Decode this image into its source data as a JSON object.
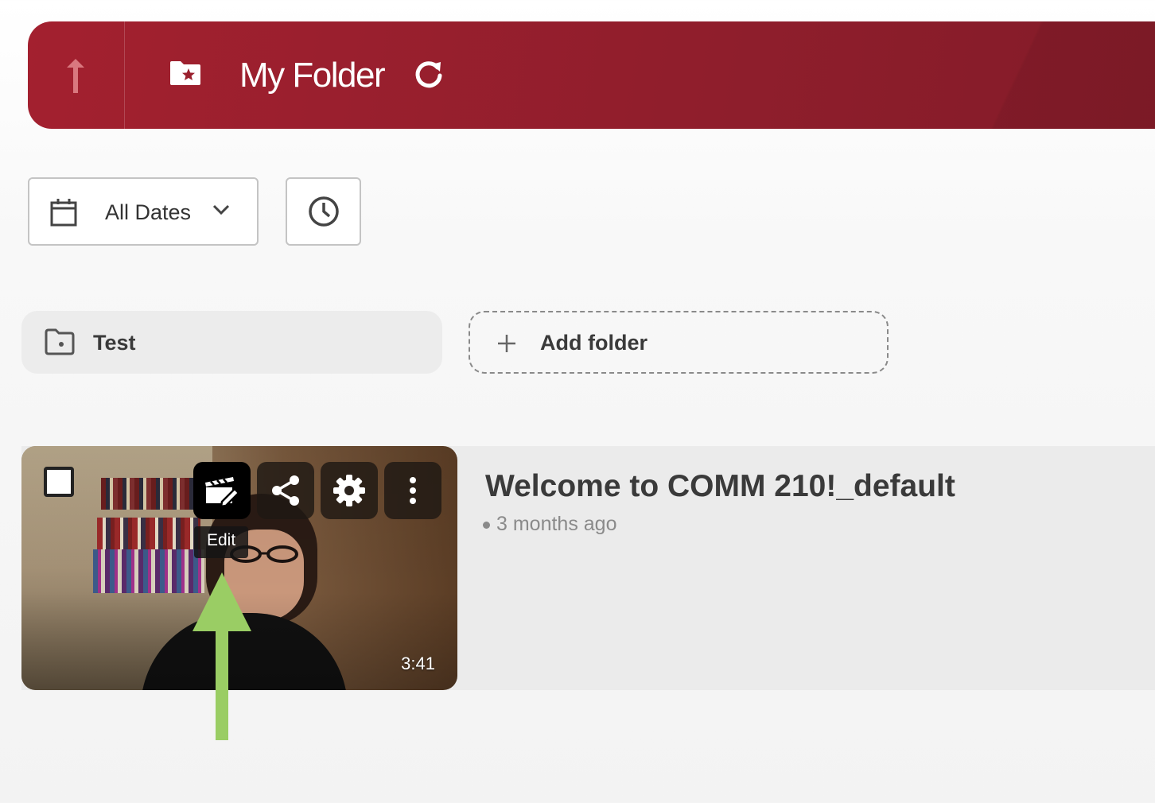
{
  "header": {
    "title": "My Folder",
    "up_icon": "arrow-up-icon",
    "folder_icon": "folder-star-icon",
    "refresh_icon": "refresh-icon",
    "accent_color": "#9a1f2d"
  },
  "filters": {
    "date_label": "All Dates",
    "date_icon": "calendar-icon",
    "dropdown_icon": "chevron-down-icon",
    "clock_icon": "clock-icon"
  },
  "folders": [
    {
      "name": "Test",
      "icon": "folder-icon"
    }
  ],
  "add_folder": {
    "label": "Add folder",
    "icon": "plus-icon"
  },
  "video": {
    "title": "Welcome to COMM 210!_default",
    "age": "3 months ago",
    "duration": "3:41",
    "tooltip": "Edit",
    "actions": [
      "edit-video-icon",
      "share-icon",
      "gear-icon",
      "more-vertical-icon"
    ]
  },
  "annotation": {
    "arrow_color": "#9acd64"
  }
}
